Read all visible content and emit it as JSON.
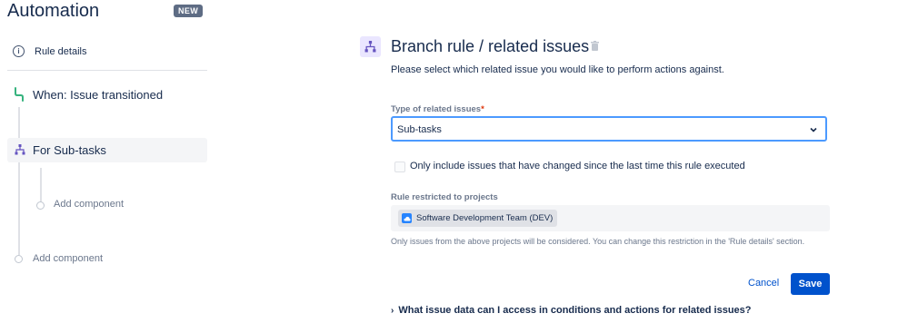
{
  "sidebar": {
    "app_title": "Automation",
    "badge": "NEW",
    "rule_details_label": "Rule details",
    "trigger_label": "When: Issue transitioned",
    "branch_label": "For Sub-tasks",
    "branch_add_component": "Add component",
    "add_component": "Add component"
  },
  "panel": {
    "title": "Branch rule / related issues",
    "subtitle": "Please select which related issue you would like to perform actions against.",
    "type_label": "Type of related issues",
    "required_mark": "*",
    "type_value": "Sub-tasks",
    "checkbox_label": "Only include issues that have changed since the last time this rule executed",
    "checkbox_checked": false,
    "projects_label": "Rule restricted to projects",
    "project_tag": "Software Development Team (DEV)",
    "help_text": "Only issues from the above projects will be considered. You can change this restriction in the 'Rule details' section.",
    "cancel_label": "Cancel",
    "save_label": "Save",
    "faq_label": "What issue data can I access in conditions and actions for related issues?"
  },
  "colors": {
    "primary": "#0052cc",
    "focus_border": "#4c9aff",
    "branch_icon_bg": "#eae6ff",
    "branch_icon": "#6554c0",
    "trigger_icon": "#36b37e"
  },
  "icons": {
    "info": "info-icon",
    "trigger": "transition-icon",
    "branch": "branch-icon",
    "trash": "trash-icon",
    "chevron": "chevron-down-icon",
    "project": "project-cloud-icon",
    "faq_caret": "chevron-right-icon"
  }
}
